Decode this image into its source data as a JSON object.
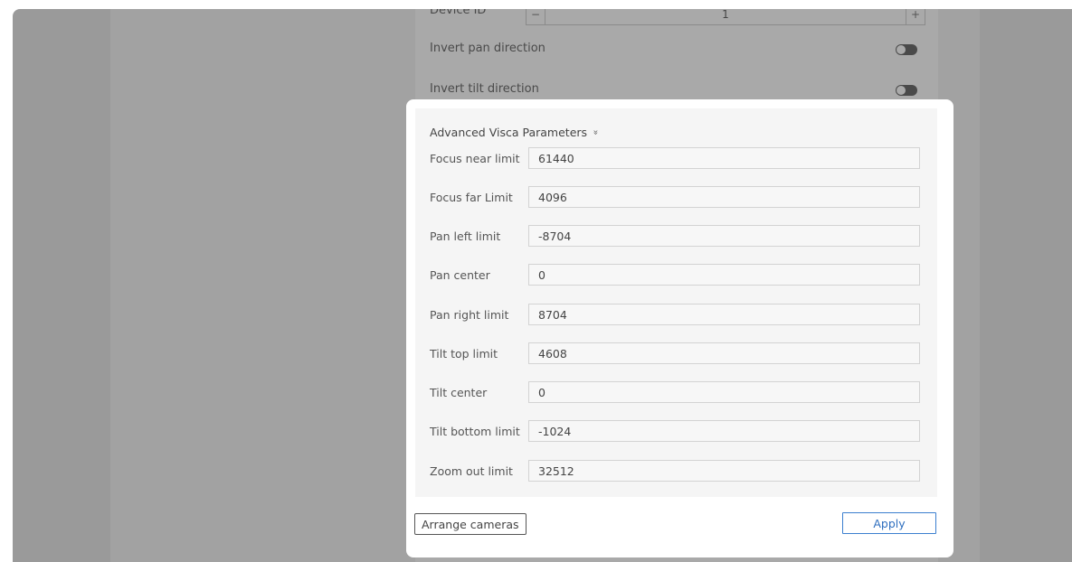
{
  "background_settings": {
    "device_id_label": "Device ID",
    "device_id_value": "1",
    "minus_symbol": "−",
    "plus_symbol": "+",
    "invert_pan_label": "Invert pan direction",
    "invert_tilt_label": "Invert tilt direction"
  },
  "visca": {
    "header": "Advanced Visca Parameters",
    "chevron": "»",
    "params": [
      {
        "label": "Focus near limit",
        "value": "61440"
      },
      {
        "label": "Focus far Limit",
        "value": "4096"
      },
      {
        "label": "Pan left limit",
        "value": "-8704"
      },
      {
        "label": "Pan center",
        "value": "0"
      },
      {
        "label": "Pan right limit",
        "value": "8704"
      },
      {
        "label": "Tilt top limit",
        "value": "4608"
      },
      {
        "label": "Tilt center",
        "value": "0"
      },
      {
        "label": "Tilt bottom limit",
        "value": "-1024"
      },
      {
        "label": "Zoom out limit",
        "value": "32512"
      }
    ]
  },
  "footer": {
    "arrange_label": "Arrange cameras",
    "apply_label": "Apply"
  },
  "colors": {
    "accent": "#3b7fcf",
    "overlay": "#9a9a9a"
  }
}
